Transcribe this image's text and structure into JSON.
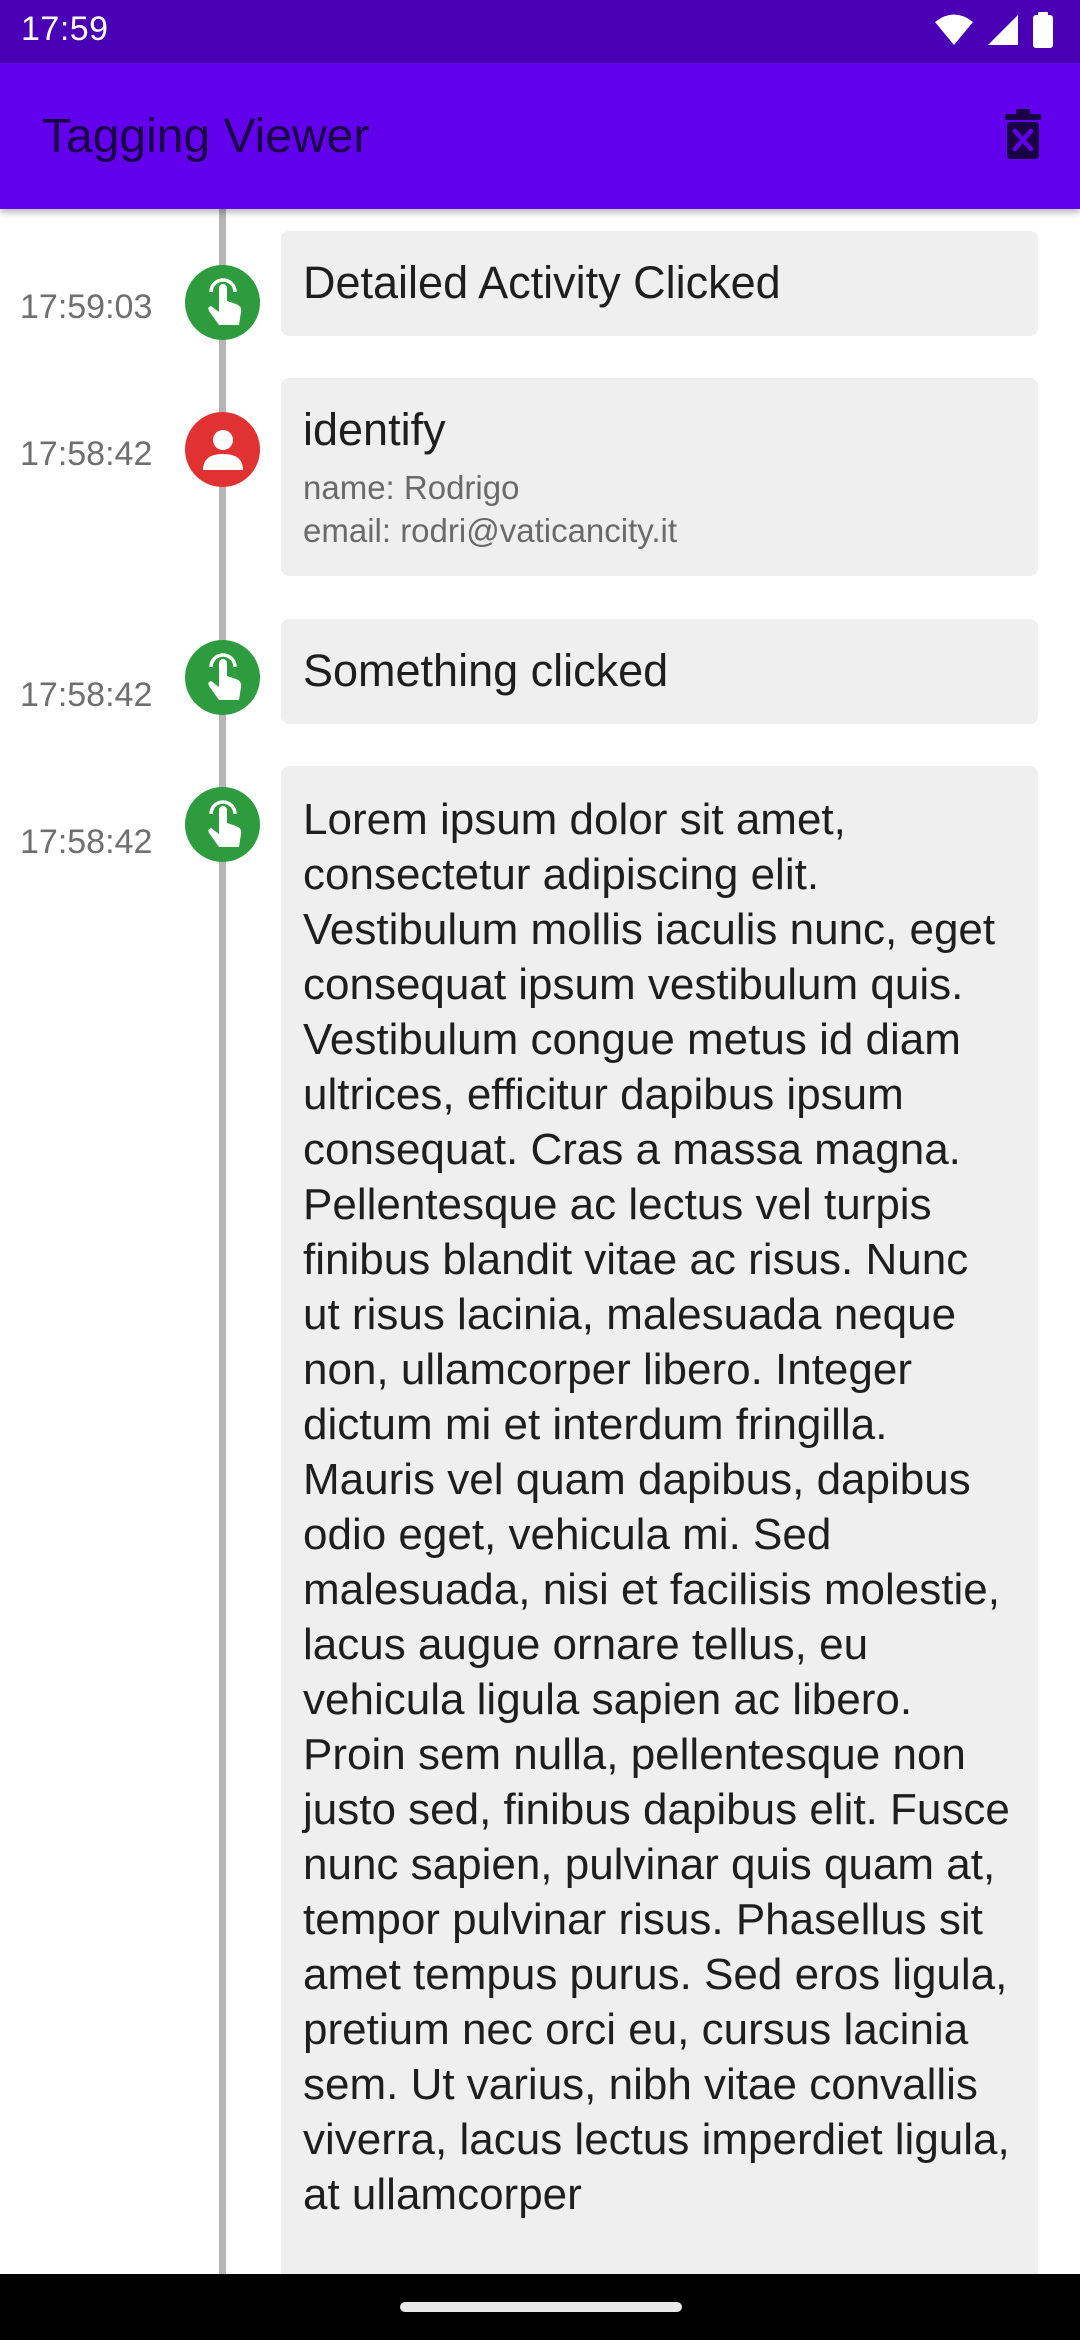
{
  "status_bar": {
    "time": "17:59",
    "icons": [
      "wifi-icon",
      "signal-icon",
      "battery-icon"
    ]
  },
  "app_bar": {
    "title": "Tagging Viewer",
    "delete_icon": "delete-icon"
  },
  "colors": {
    "status_bar": "#4a00b4",
    "app_bar": "#6200ee",
    "tap_event": "#2e9c3e",
    "identify_event": "#e03232",
    "card_background": "#efefef",
    "timeline_line": "#b5b5b5"
  },
  "entries": [
    {
      "time": "17:59:03",
      "icon": "tap-icon",
      "title": "Detailed Activity Clicked"
    },
    {
      "time": "17:58:42",
      "icon": "person-icon",
      "title": "identify",
      "details": [
        "name: Rodrigo",
        "email: rodri@vaticancity.it"
      ]
    },
    {
      "time": "17:58:42",
      "icon": "tap-icon",
      "title": "Something clicked"
    },
    {
      "time": "17:58:42",
      "icon": "tap-icon",
      "title": "Lorem ipsum dolor sit amet, consectetur adipiscing elit. Vestibulum mollis iaculis nunc, eget consequat ipsum vestibulum quis. Vestibulum congue metus id diam ultrices, efficitur dapibus ipsum consequat. Cras a massa magna. Pellentesque ac lectus vel turpis finibus blandit vitae ac risus. Nunc ut risus lacinia, malesuada neque non, ullamcorper libero. Integer dictum mi et interdum fringilla. Mauris vel quam dapibus, dapibus odio eget, vehicula mi. Sed malesuada, nisi et facilisis molestie, lacus augue ornare tellus, eu vehicula ligula sapien ac libero. Proin sem nulla, pellentesque non justo sed, finibus dapibus elit. Fusce nunc sapien, pulvinar quis quam at, tempor pulvinar risus. Phasellus sit amet tempus purus. Sed eros ligula, pretium nec orci eu, cursus lacinia sem. Ut varius, nibh vitae convallis viverra, lacus lectus imperdiet ligula, at ullamcorper"
    }
  ]
}
